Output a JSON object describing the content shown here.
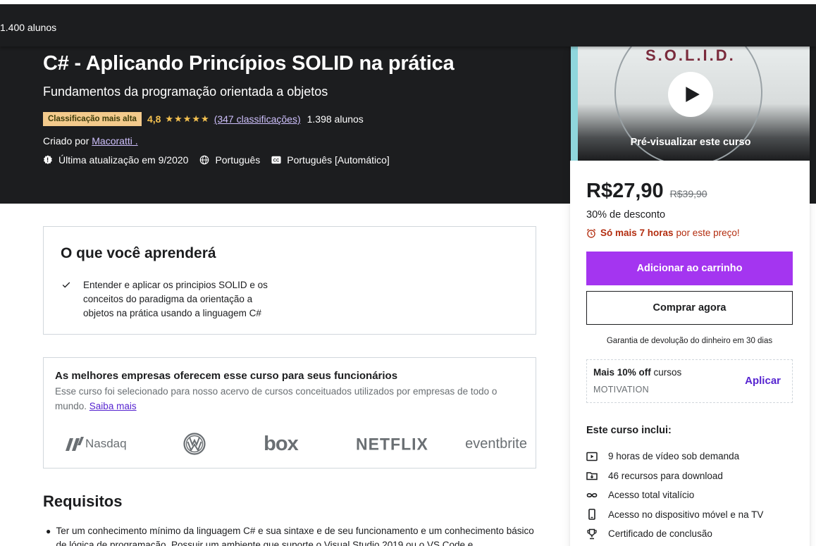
{
  "sticky": {
    "students": "1.400 alunos"
  },
  "hero": {
    "title": "C# - Aplicando Princípios SOLID na prática",
    "subtitle": "Fundamentos da programação orientada a objetos",
    "badge": "Classificação mais alta",
    "rating": "4,8",
    "stars_glyphs": "★★★★★",
    "ratings_link": "(347 classificações)",
    "students": "1.398 alunos",
    "created_label": "Criado por",
    "author": "Macoratti .",
    "updated": "Última atualização em 9/2020",
    "language": "Português",
    "captions": "Português [Automático]"
  },
  "sidebar": {
    "preview_image_text": "S.O.L.I.D.",
    "preview_label": "Pré-visualizar este curso",
    "price": "R$27,90",
    "old_price": "R$39,90",
    "discount": "30% de desconto",
    "timer_bold": "Só mais 7 horas",
    "timer_rest": "por este preço!",
    "add_to_cart": "Adicionar ao carrinho",
    "buy_now": "Comprar agora",
    "guarantee": "Garantia de devolução do dinheiro em 30 dias",
    "coupon": {
      "bold": "Mais 10% off",
      "rest": "cursos",
      "code": "MOTIVATION",
      "apply": "Aplicar"
    },
    "includes_title": "Este curso inclui:",
    "includes": [
      {
        "icon": "video-icon",
        "text": "9 horas de vídeo sob demanda"
      },
      {
        "icon": "download-icon",
        "text": "46 recursos para download"
      },
      {
        "icon": "infinity-icon",
        "text": "Acesso total vitalício"
      },
      {
        "icon": "mobile-icon",
        "text": "Acesso no dispositivo móvel e na TV"
      },
      {
        "icon": "trophy-icon",
        "text": "Certificado de conclusão"
      }
    ]
  },
  "learn": {
    "title": "O que você aprenderá",
    "items": [
      "Entender e aplicar os principios SOLID e os conceitos do paradigma da orientação a objetos na prática usando a linguagem C#"
    ]
  },
  "companies": {
    "title": "As melhores empresas oferecem esse curso para seus funcionários",
    "desc": "Esse curso foi selecionado para nosso acervo de cursos conceituados utilizados por empresas de todo o mundo.",
    "link": "Saiba mais",
    "logos": [
      "Nasdaq",
      "box",
      "NETFLIX",
      "eventbrite"
    ]
  },
  "requirements": {
    "title": "Requisitos",
    "items": [
      "Ter um conhecimento mínimo da linguagem C# e sua sintaxe e de seu funcionamento e um conhecimento básico de lógica de programação. Possuir um ambiente que suporte o Visual Studio 2019 ou o VS Code e"
    ]
  },
  "colors": {
    "dark_bg": "#1c1d1f",
    "purple": "#a435f0",
    "link_purple": "#5624d0",
    "star": "#f4c150",
    "timer_red": "#b32d0f"
  }
}
